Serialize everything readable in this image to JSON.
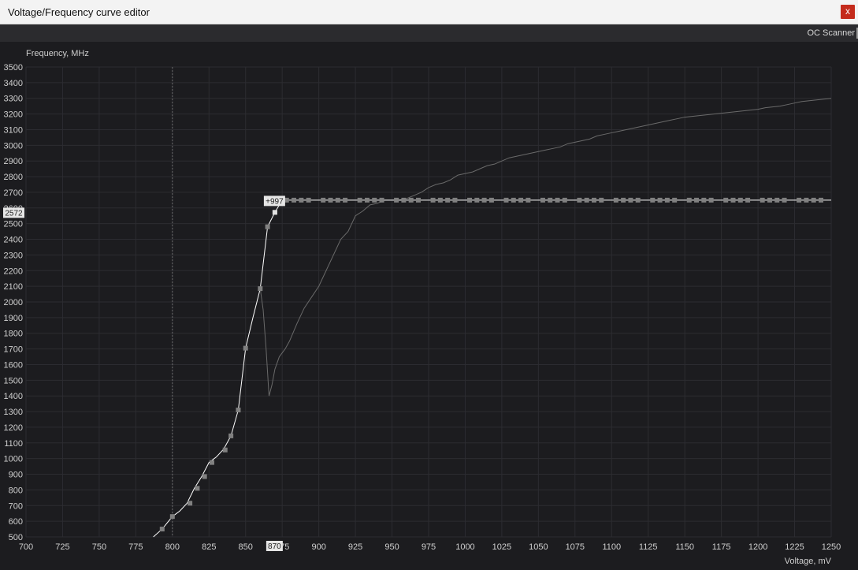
{
  "window": {
    "title": "Voltage/Frequency curve editor",
    "close_label": "x"
  },
  "toolbar": {
    "oc_scanner_label": "OC Scanner"
  },
  "colors": {
    "background": "#1c1c1f",
    "grid": "#2c2c31",
    "curve": "#ffffff",
    "reference_curve": "#6a6a6a",
    "marker": "#808080",
    "close_button": "#c42b1c"
  },
  "chart_data": {
    "type": "line",
    "xlabel": "Voltage, mV",
    "ylabel": "Frequency, MHz",
    "xlim": [
      700,
      1250
    ],
    "ylim": [
      500,
      3500
    ],
    "x_ticks": [
      700,
      725,
      750,
      775,
      800,
      825,
      850,
      875,
      900,
      925,
      950,
      975,
      1000,
      1025,
      1050,
      1075,
      1100,
      1125,
      1150,
      1175,
      1200,
      1225,
      1250
    ],
    "y_ticks": [
      500,
      600,
      700,
      800,
      900,
      1000,
      1100,
      1200,
      1300,
      1400,
      1500,
      1600,
      1700,
      1800,
      1900,
      2000,
      2100,
      2200,
      2300,
      2400,
      2500,
      2600,
      2700,
      2800,
      2900,
      3000,
      3100,
      3200,
      3300,
      3400,
      3500
    ],
    "vertical_marker_voltage": 800,
    "selected_point": {
      "voltage": 870,
      "frequency": 2572,
      "voltage_label": "870",
      "frequency_label": "2572",
      "offset_label": "+997"
    },
    "series": [
      {
        "role": "curve",
        "x": [
          787,
          793,
          800,
          805,
          810,
          815,
          820,
          825,
          830,
          835,
          840,
          845,
          850,
          855,
          860,
          865,
          870,
          875,
          880,
          885,
          890,
          895,
          900,
          905,
          910,
          915,
          920,
          925,
          930,
          935,
          940,
          945,
          950,
          955,
          960,
          965,
          970,
          975,
          980,
          985,
          990,
          995,
          1000,
          1005,
          1010,
          1015,
          1020,
          1025,
          1030,
          1035,
          1040,
          1045,
          1050,
          1055,
          1060,
          1065,
          1070,
          1075,
          1080,
          1085,
          1090,
          1095,
          1100,
          1105,
          1110,
          1115,
          1120,
          1125,
          1130,
          1135,
          1140,
          1145,
          1150,
          1155,
          1160,
          1165,
          1170,
          1175,
          1180,
          1185,
          1190,
          1195,
          1200,
          1205,
          1210,
          1215,
          1220,
          1225,
          1230,
          1235,
          1240,
          1245,
          1250
        ],
        "y": [
          450,
          550,
          630,
          665,
          715,
          810,
          885,
          975,
          1010,
          1060,
          1145,
          1310,
          1705,
          1900,
          2085,
          2480,
          2572,
          2650,
          2650,
          2650,
          2650,
          2650,
          2650,
          2650,
          2650,
          2650,
          2650,
          2650,
          2650,
          2650,
          2650,
          2650,
          2650,
          2650,
          2650,
          2650,
          2650,
          2650,
          2650,
          2650,
          2650,
          2650,
          2650,
          2650,
          2650,
          2650,
          2650,
          2650,
          2650,
          2650,
          2650,
          2650,
          2650,
          2650,
          2650,
          2650,
          2650,
          2650,
          2650,
          2650,
          2650,
          2650,
          2650,
          2650,
          2650,
          2650,
          2650,
          2650,
          2650,
          2650,
          2650,
          2650,
          2650,
          2650,
          2650,
          2650,
          2650,
          2650,
          2650,
          2650,
          2650,
          2650,
          2650,
          2650,
          2650,
          2650,
          2650,
          2650,
          2650,
          2650,
          2650,
          2650,
          2650
        ]
      },
      {
        "role": "reference",
        "x": [
          860,
          862,
          864,
          866,
          868,
          870,
          873,
          877,
          880,
          885,
          890,
          895,
          900,
          905,
          910,
          915,
          920,
          925,
          930,
          935,
          940,
          945,
          950,
          955,
          960,
          965,
          970,
          975,
          980,
          985,
          990,
          995,
          1000,
          1005,
          1010,
          1015,
          1020,
          1025,
          1030,
          1035,
          1040,
          1045,
          1050,
          1055,
          1060,
          1065,
          1070,
          1075,
          1080,
          1085,
          1090,
          1095,
          1100,
          1105,
          1110,
          1115,
          1120,
          1125,
          1130,
          1135,
          1140,
          1145,
          1150,
          1155,
          1160,
          1165,
          1170,
          1175,
          1180,
          1185,
          1190,
          1195,
          1200,
          1205,
          1210,
          1215,
          1220,
          1225,
          1230,
          1235,
          1240,
          1245,
          1250
        ],
        "y": [
          2085,
          1950,
          1700,
          1400,
          1470,
          1570,
          1650,
          1700,
          1750,
          1860,
          1960,
          2030,
          2100,
          2200,
          2300,
          2400,
          2450,
          2550,
          2580,
          2620,
          2630,
          2650,
          2650,
          2650,
          2660,
          2680,
          2700,
          2730,
          2750,
          2760,
          2780,
          2810,
          2820,
          2830,
          2850,
          2870,
          2880,
          2900,
          2920,
          2930,
          2940,
          2950,
          2960,
          2970,
          2980,
          2990,
          3010,
          3020,
          3030,
          3040,
          3060,
          3070,
          3080,
          3090,
          3100,
          3110,
          3120,
          3130,
          3140,
          3150,
          3160,
          3170,
          3180,
          3185,
          3190,
          3195,
          3200,
          3205,
          3210,
          3215,
          3220,
          3225,
          3230,
          3240,
          3245,
          3250,
          3260,
          3270,
          3280,
          3285,
          3290,
          3295,
          3300
        ]
      }
    ],
    "marker_points": {
      "voltages": [
        793,
        800,
        812,
        817,
        822,
        827,
        836,
        840,
        845,
        850,
        860,
        865,
        870,
        878,
        883,
        888,
        893,
        903,
        908,
        913,
        918,
        928,
        933,
        938,
        943,
        953,
        958,
        963,
        968,
        978,
        983,
        988,
        993,
        1003,
        1008,
        1013,
        1018,
        1028,
        1033,
        1038,
        1043,
        1053,
        1058,
        1063,
        1068,
        1078,
        1083,
        1088,
        1093,
        1103,
        1108,
        1113,
        1118,
        1128,
        1133,
        1138,
        1143,
        1153,
        1158,
        1163,
        1168,
        1178,
        1183,
        1188,
        1193,
        1203,
        1208,
        1213,
        1218,
        1228,
        1233,
        1238,
        1243
      ],
      "frequencies": [
        550,
        630,
        715,
        810,
        885,
        975,
        1055,
        1145,
        1310,
        1705,
        2085,
        2480,
        2572,
        2650,
        2650,
        2650,
        2650,
        2650,
        2650,
        2650,
        2650,
        2650,
        2650,
        2650,
        2650,
        2650,
        2650,
        2650,
        2650,
        2650,
        2650,
        2650,
        2650,
        2650,
        2650,
        2650,
        2650,
        2650,
        2650,
        2650,
        2650,
        2650,
        2650,
        2650,
        2650,
        2650,
        2650,
        2650,
        2650,
        2650,
        2650,
        2650,
        2650,
        2650,
        2650,
        2650,
        2650,
        2650,
        2650,
        2650,
        2650,
        2650,
        2650,
        2650,
        2650,
        2650,
        2650,
        2650,
        2650,
        2650,
        2650,
        2650,
        2650
      ]
    }
  }
}
